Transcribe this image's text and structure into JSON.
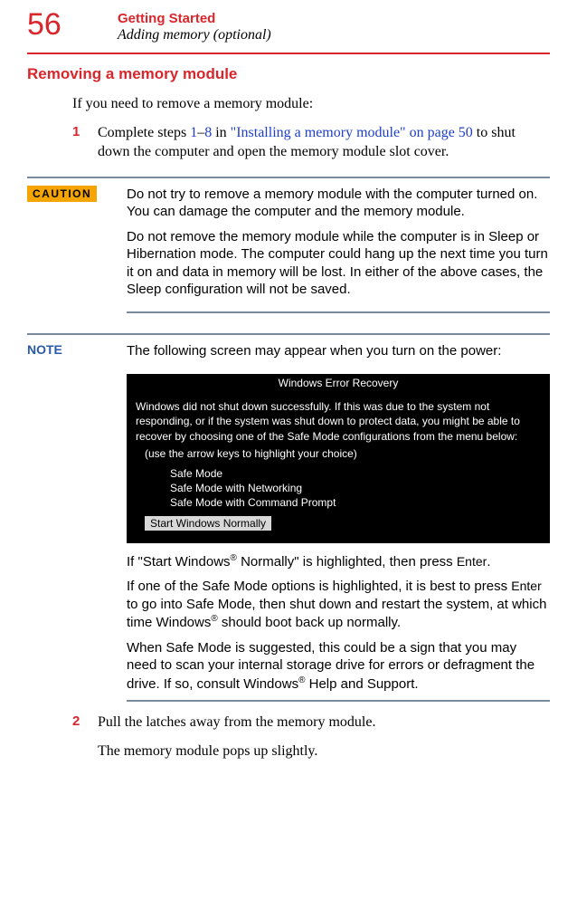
{
  "page_number": "56",
  "chapter_title": "Getting Started",
  "section_sub": "Adding memory (optional)",
  "heading": "Removing a memory module",
  "intro": "If you need to remove a memory module:",
  "step1_num": "1",
  "step1_a": "Complete steps ",
  "step1_link1": "1",
  "step1_dash": "–",
  "step1_link2": "8",
  "step1_b": " in ",
  "step1_link3": "\"Installing a memory module\" on page 50",
  "step1_c": " to shut down the computer and open the memory module slot cover.",
  "caution_label": "CAUTION",
  "caution_p1": "Do not try to remove a memory module with the computer turned on. You can damage the computer and the memory module.",
  "caution_p2": "Do not remove the memory module while the computer is in Sleep or Hibernation mode. The computer could hang up the next time you turn it on and data in memory will be lost. In either of the above cases, the Sleep configuration will not be saved.",
  "note_label": "NOTE",
  "note_intro": "The following screen may appear when you turn on the power:",
  "screenshot": {
    "title": "Windows Error Recovery",
    "para": "Windows did not shut down successfully. If this was due to the system not responding, or if the system was shut down to protect data, you might be able to recover by choosing one of the Safe Mode configurations from the menu below:",
    "hint": "(use the arrow keys to highlight your choice)",
    "opt1": "Safe Mode",
    "opt2": "Safe Mode with Networking",
    "opt3": "Safe Mode with Command Prompt",
    "opt4": "Start Windows Normally"
  },
  "note_p1_a": "If \"Start Windows",
  "reg": "®",
  "note_p1_b": " Normally\" is highlighted, then press ",
  "enter_key": "Enter",
  "period": ".",
  "note_p2_a": "If one of the Safe Mode options is highlighted, it is best to press ",
  "note_p2_b": " to go into Safe Mode, then shut down and restart the system, at which time Windows",
  "note_p2_c": " should boot back up normally.",
  "note_p3_a": "When Safe Mode is suggested, this could be a sign that you may need to scan your internal storage drive for errors or defragment the drive. If so, consult Windows",
  "note_p3_b": " Help and Support.",
  "step2_num": "2",
  "step2_text": "Pull the latches away from the memory module.",
  "step2_sub": "The memory module pops up slightly."
}
